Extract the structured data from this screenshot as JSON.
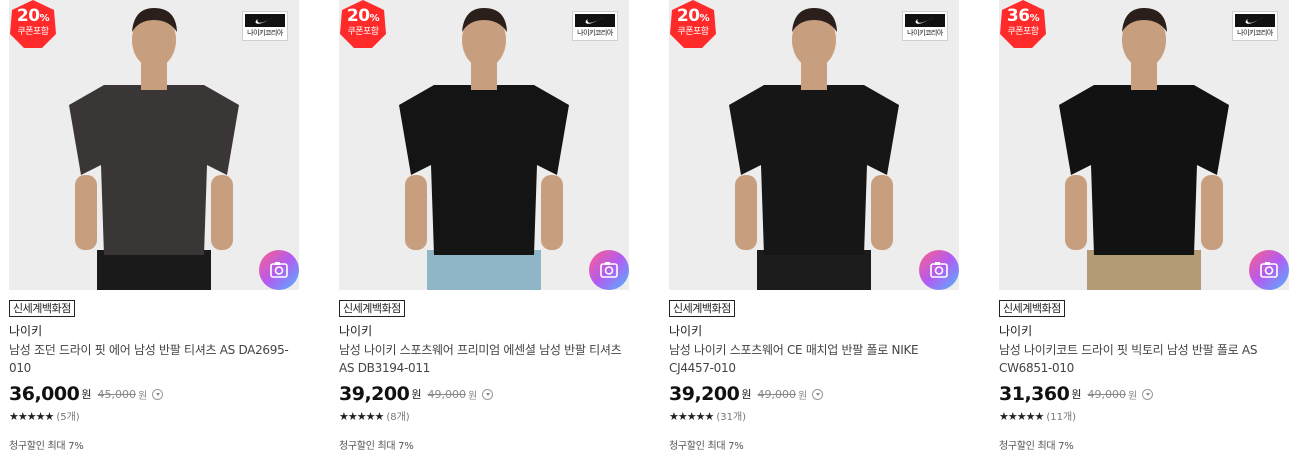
{
  "colors": {
    "coupon_red": "#ff2a2a",
    "text": "#222222",
    "muted": "#888888"
  },
  "products": [
    {
      "coupon_percent": "20",
      "coupon_symbol": "%",
      "coupon_label": "쿠폰포함",
      "brand_badge": "나이키코리아",
      "store": "신세계백화점",
      "brand": "나이키",
      "name": "남성 조던 드라이 핏 에어 남성 반팔 티셔츠 AS DA2695-010",
      "price": "36,000",
      "currency": "원",
      "original_price": "45,000",
      "stars": "★★★★★",
      "review_count": "(5개)",
      "card_discount": "청구할인 최대 7%",
      "shirt_color": "#3b3636",
      "pants_color": "#1a1a1a",
      "icon": "camera-search-icon"
    },
    {
      "coupon_percent": "20",
      "coupon_symbol": "%",
      "coupon_label": "쿠폰포함",
      "brand_badge": "나이키코리아",
      "store": "신세계백화점",
      "brand": "나이키",
      "name": "남성 나이키 스포츠웨어 프리미엄 에센셜 남성 반팔 티셔츠 AS DB3194-011",
      "price": "39,200",
      "currency": "원",
      "original_price": "49,000",
      "stars": "★★★★★",
      "review_count": "(8개)",
      "card_discount": "청구할인 최대 7%",
      "shirt_color": "#141414",
      "pants_color": "#8fb6c7",
      "icon": "camera-search-icon"
    },
    {
      "coupon_percent": "20",
      "coupon_symbol": "%",
      "coupon_label": "쿠폰포함",
      "brand_badge": "나이키코리아",
      "store": "신세계백화점",
      "brand": "나이키",
      "name": "남성 나이키 스포츠웨어 CE 매치업 반팔 폴로 NIKE CJ4457-010",
      "price": "39,200",
      "currency": "원",
      "original_price": "49,000",
      "stars": "★★★★★",
      "review_count": "(31개)",
      "card_discount": "청구할인 최대 7%",
      "shirt_color": "#161616",
      "pants_color": "#1c1c1c",
      "icon": "camera-search-icon"
    },
    {
      "coupon_percent": "36",
      "coupon_symbol": "%",
      "coupon_label": "쿠폰포함",
      "brand_badge": "나이키코리아",
      "store": "신세계백화점",
      "brand": "나이키",
      "name": "남성 나이키코트 드라이 핏 빅토리 남성 반팔 폴로 AS CW6851-010",
      "price": "31,360",
      "currency": "원",
      "original_price": "49,000",
      "stars": "★★★★★",
      "review_count": "(11개)",
      "card_discount": "청구할인 최대 7%",
      "shirt_color": "#121212",
      "pants_color": "#b39c74",
      "icon": "camera-search-icon"
    }
  ]
}
